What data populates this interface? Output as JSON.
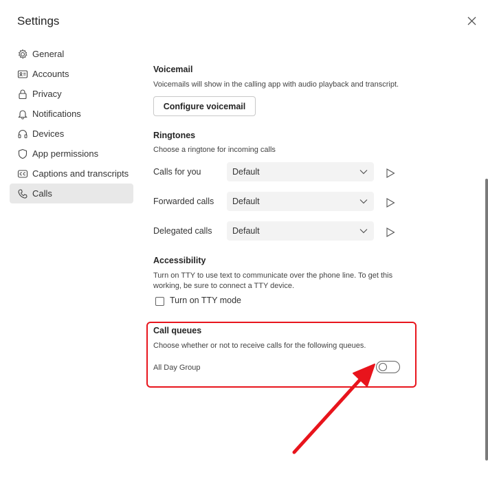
{
  "header": {
    "title": "Settings"
  },
  "sidebar": {
    "items": [
      {
        "label": "General"
      },
      {
        "label": "Accounts"
      },
      {
        "label": "Privacy"
      },
      {
        "label": "Notifications"
      },
      {
        "label": "Devices"
      },
      {
        "label": "App permissions"
      },
      {
        "label": "Captions and transcripts"
      },
      {
        "label": "Calls"
      }
    ]
  },
  "voicemail": {
    "title": "Voicemail",
    "desc": "Voicemails will show in the calling app with audio playback and transcript.",
    "button": "Configure voicemail"
  },
  "ringtones": {
    "title": "Ringtones",
    "desc": "Choose a ringtone for incoming calls",
    "rows": [
      {
        "label": "Calls for you",
        "value": "Default"
      },
      {
        "label": "Forwarded calls",
        "value": "Default"
      },
      {
        "label": "Delegated calls",
        "value": "Default"
      }
    ]
  },
  "accessibility": {
    "title": "Accessibility",
    "desc": "Turn on TTY to use text to communicate over the phone line. To get this working, be sure to connect a TTY device.",
    "checkbox_label": "Turn on TTY mode"
  },
  "call_queues": {
    "title": "Call queues",
    "desc": "Choose whether or not to receive calls for the following queues.",
    "queue_label": "All Day Group",
    "toggle_on": false
  },
  "colors": {
    "highlight": "#e8141c",
    "arrow": "#e8141c"
  }
}
